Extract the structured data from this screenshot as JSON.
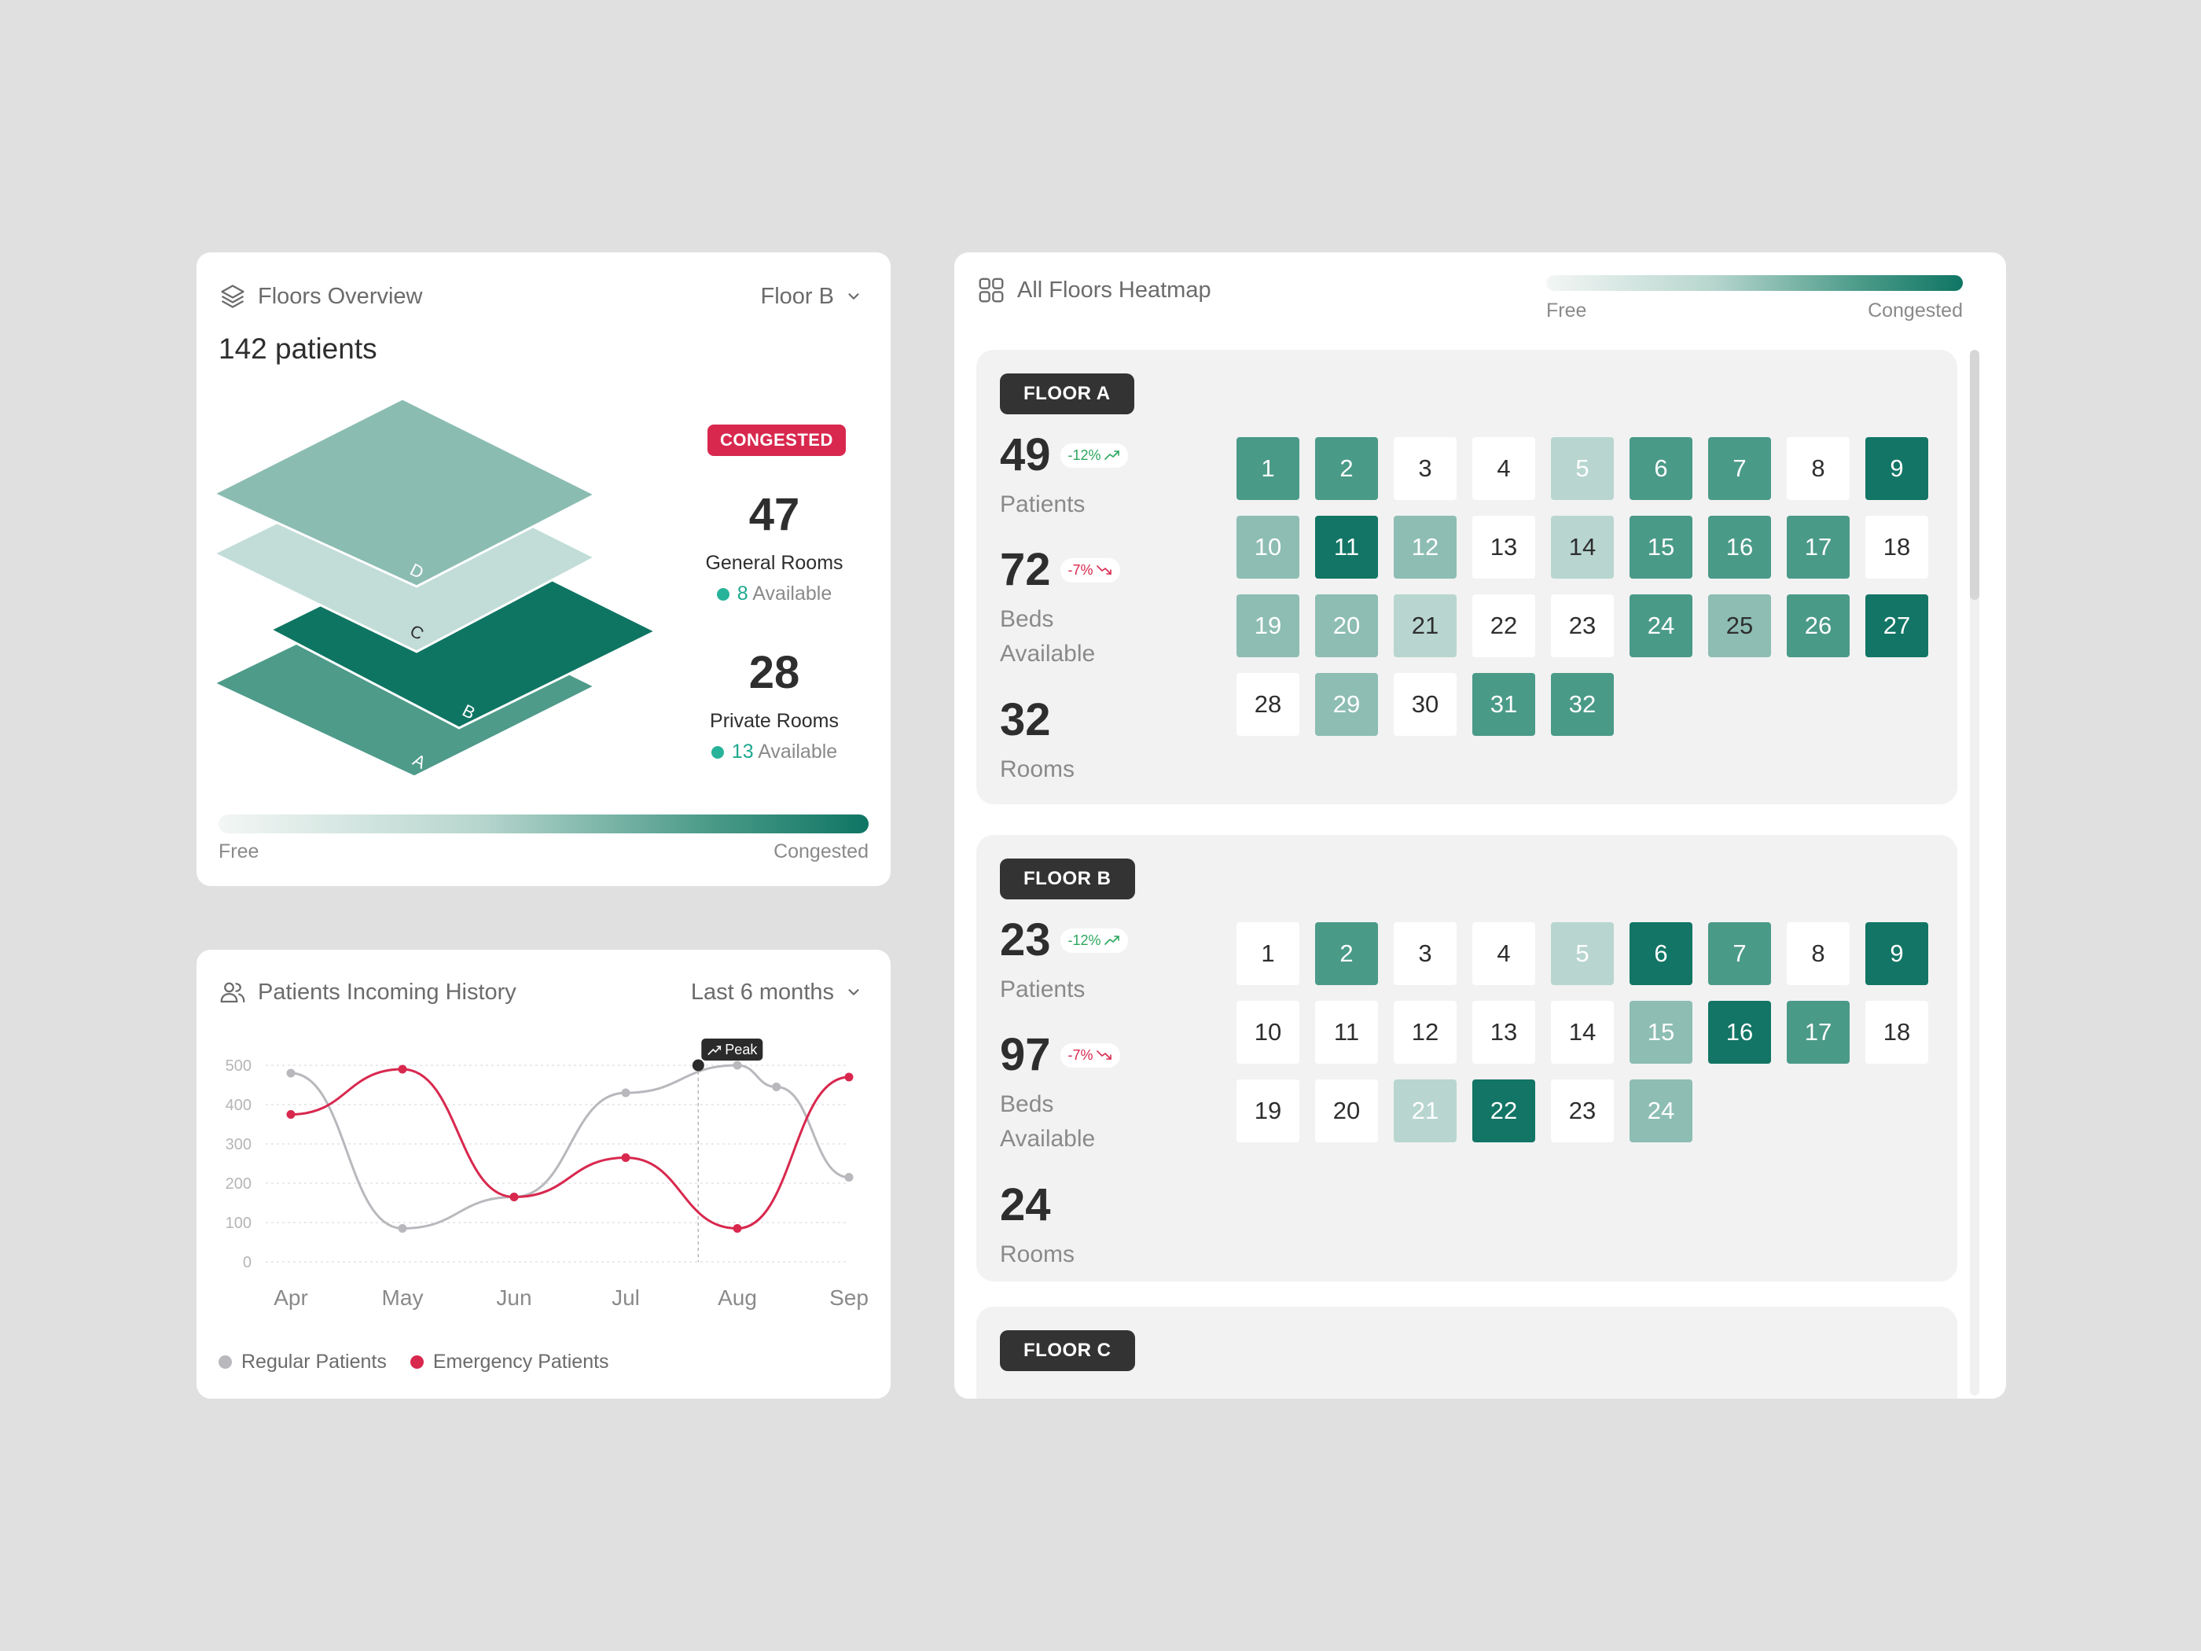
{
  "floors_overview": {
    "title": "Floors Overview",
    "selected_floor": "Floor B",
    "patients_total": "142 patients",
    "status_badge": "CONGESTED",
    "layers": [
      "A",
      "B",
      "C",
      "D"
    ],
    "general_rooms": {
      "count": "47",
      "label": "General Rooms",
      "available_count": "8",
      "available_label": "Available"
    },
    "private_rooms": {
      "count": "28",
      "label": "Private Rooms",
      "available_count": "13",
      "available_label": "Available"
    },
    "scale": {
      "low": "Free",
      "high": "Congested"
    }
  },
  "history": {
    "title": "Patients Incoming History",
    "range": "Last 6 months",
    "peak_label": "Peak",
    "legend": {
      "regular": "Regular Patients",
      "emergency": "Emergency Patients"
    }
  },
  "chart_data": {
    "type": "line",
    "x": [
      "Apr",
      "May",
      "Jun",
      "Jul",
      "Aug",
      "Sep"
    ],
    "ylim": [
      0,
      500
    ],
    "yticks": [
      0,
      100,
      200,
      300,
      400,
      500
    ],
    "series": [
      {
        "name": "Regular Patients",
        "values": [
          480,
          85,
          165,
          430,
          500,
          215
        ],
        "extra_points": [
          {
            "x": 4.35,
            "y": 445
          }
        ]
      },
      {
        "name": "Emergency Patients",
        "values": [
          375,
          490,
          165,
          265,
          85,
          470
        ]
      }
    ],
    "peak": {
      "series": "Regular Patients",
      "x": "Aug",
      "y": 500
    },
    "colors": {
      "Regular Patients": "#b8b8bd",
      "Emergency Patients": "#d8284e"
    },
    "grid": true
  },
  "heatmap": {
    "title": "All Floors Heatmap",
    "scale": {
      "low": "Free",
      "high": "Congested"
    },
    "floors": [
      {
        "tag": "FLOOR A",
        "patients": "49",
        "patients_label": "Patients",
        "patients_change": "-12%",
        "patients_trend": "up",
        "beds": "72",
        "beds_label": "Beds\nAvailable",
        "beds_change": "-7%",
        "beds_trend": "down",
        "rooms": "32",
        "rooms_label": "Rooms",
        "room_levels": [
          3,
          3,
          0,
          0,
          1,
          3,
          3,
          0,
          4,
          2,
          4,
          2,
          0,
          1,
          3,
          3,
          3,
          0,
          2,
          2,
          1,
          0,
          0,
          3,
          2,
          3,
          4,
          0,
          2,
          0,
          3,
          3
        ]
      },
      {
        "tag": "FLOOR B",
        "patients": "23",
        "patients_label": "Patients",
        "patients_change": "-12%",
        "patients_trend": "up",
        "beds": "97",
        "beds_label": "Beds\nAvailable",
        "beds_change": "-7%",
        "beds_trend": "down",
        "rooms": "24",
        "rooms_label": "Rooms",
        "room_levels": [
          0,
          3,
          0,
          0,
          1,
          4,
          3,
          0,
          4,
          0,
          0,
          0,
          0,
          0,
          2,
          4,
          3,
          0,
          0,
          0,
          1,
          4,
          0,
          2
        ]
      },
      {
        "tag": "FLOOR C"
      }
    ]
  }
}
